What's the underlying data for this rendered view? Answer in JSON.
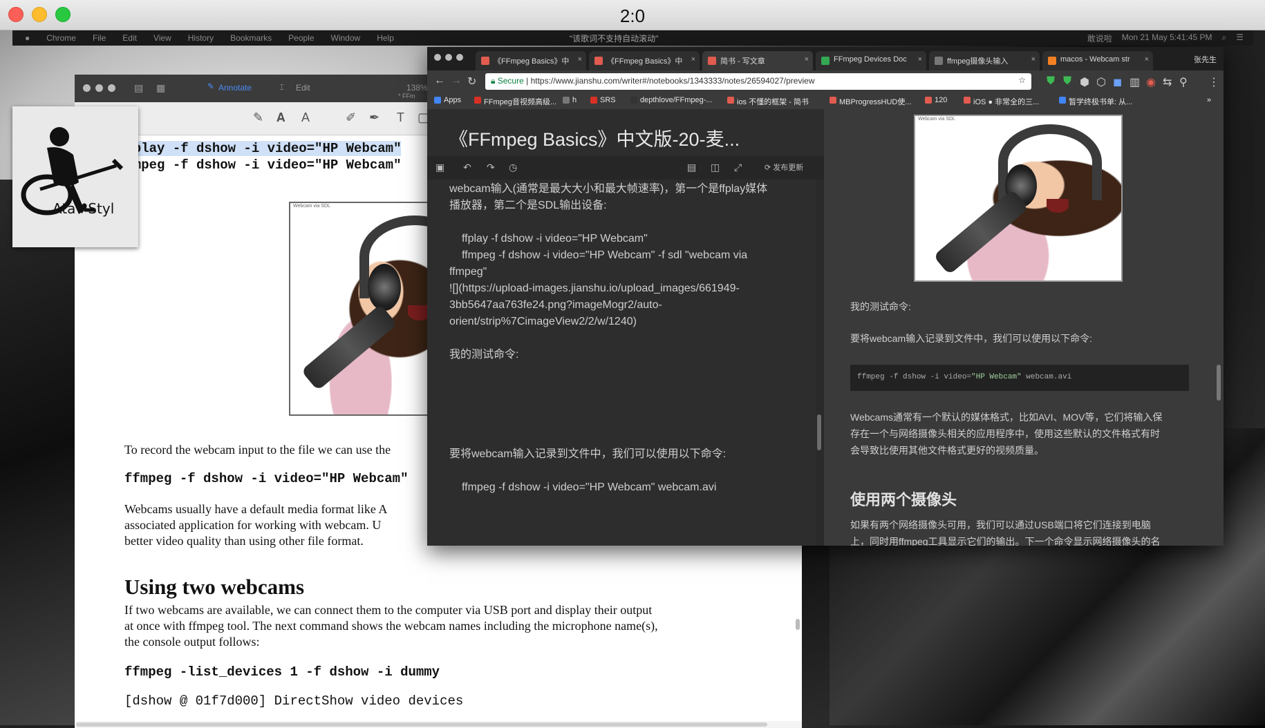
{
  "window": {
    "title": "2:0"
  },
  "menubar": {
    "items": [
      "Chrome",
      "File",
      "Edit",
      "View",
      "History",
      "Bookmarks",
      "People",
      "Window",
      "Help"
    ],
    "center_notice": "\"该歌词不支持自动滚动\"",
    "clock": "Mon 21 May  5:41:45 PM",
    "user": "敢说啦"
  },
  "pdf": {
    "toolbar": {
      "annotate": "Annotate",
      "edit": "Edit",
      "zoom": "138%",
      "filename": "* FFm"
    },
    "tools": [
      "✎",
      "𝐀",
      "A",
      "✐",
      "✒",
      "T",
      "▢"
    ],
    "cmd1": "ffplay -f dshow -i video=\"HP Webcam\"",
    "cmd2": "ffmpeg -f dshow -i video=\"HP Webcam\"",
    "photo_caption": "Webcam via SDL",
    "para1": "To record the webcam input to the file we can use the",
    "cmd3": "ffmpeg -f dshow -i video=\"HP Webcam\"",
    "para2_l1": "Webcams usually have a default media format like A",
    "para2_l2": "associated application for working with webcam. U",
    "para2_l3": "better video quality than using other file format.",
    "heading": "Using two webcams",
    "para3_l1": "If two webcams are available, we can connect them to the computer via USB port and display their output",
    "para3_l2": "at once with ffmpeg tool. The next command shows the webcam names including the microphone name(s),",
    "para3_l3": "the console output follows:",
    "cmd4": "ffmpeg -list_devices 1 -f dshow -i dummy",
    "cmd5": "[dshow @ 01f7d000] DirectShow video devices"
  },
  "logo": {
    "text": "Ata♥Styl"
  },
  "chrome": {
    "tabs": [
      {
        "label": "《FFmpeg Basics》中",
        "color": "#e15b4f"
      },
      {
        "label": "《FFmpeg Basics》中",
        "color": "#e15b4f"
      },
      {
        "label": "简书 - 写文章",
        "color": "#e15b4f"
      },
      {
        "label": "FFmpeg Devices Doc",
        "color": "#34a853"
      },
      {
        "label": "ffmpeg摄像头输入",
        "color": "#777777"
      },
      {
        "label": "macos - Webcam str",
        "color": "#f48024"
      }
    ],
    "profile": "张先生",
    "url_secure": "Secure",
    "url": "https://www.jianshu.com/writer#/notebooks/1343333/notes/26594027/preview",
    "bookmarks": [
      {
        "label": "Apps",
        "color": "#4285f4"
      },
      {
        "label": "FFmpeg音视频高级...",
        "color": "#d93025"
      },
      {
        "label": "h",
        "color": "#777777"
      },
      {
        "label": "SRS",
        "color": "#d93025"
      },
      {
        "label": "depthlove/FFmpeg-...",
        "color": "#333333"
      },
      {
        "label": "ios 不懂的框架 - 简书",
        "color": "#e15b4f"
      },
      {
        "label": "MBProgressHUD使...",
        "color": "#e15b4f"
      },
      {
        "label": "120",
        "color": "#e15b4f"
      },
      {
        "label": "iOS ● 非常全的三...",
        "color": "#e15b4f"
      },
      {
        "label": "暂学终极书单: 从...",
        "color": "#4285f4"
      }
    ]
  },
  "editor": {
    "title": "《FFmpeg Basics》中文版-20-麦...",
    "publish": "发布更新",
    "lines": [
      "webcam输入(通常是最大大小和最大帧速率)，第一个是ffplay媒体",
      "播放器，第二个是SDL输出设备:",
      "ffplay -f dshow -i video=\"HP Webcam\"",
      "ffmpeg -f dshow -i video=\"HP Webcam\" -f sdl \"webcam via",
      "ffmpeg\"",
      "![](https://upload-images.jianshu.io/upload_images/661949-",
      "3bb5647aa763fe24.png?imageMogr2/auto-",
      "orient/strip%7CimageView2/2/w/1240)",
      "我的测试命令:",
      "要将webcam输入记录到文件中，我们可以使用以下命令:",
      "ffmpeg -f dshow -i video=\"HP Webcam\" webcam.avi"
    ]
  },
  "preview": {
    "p1": "我的测试命令:",
    "p2": "要将webcam输入记录到文件中，我们可以使用以下命令:",
    "code_prefix": "ffmpeg -f dshow -i video=",
    "code_string": "\"HP Webcam\"",
    "code_suffix": " webcam.avi",
    "p3_l1": "Webcams通常有一个默认的媒体格式，比如AVI、MOV等，它们将输入保",
    "p3_l2": "存在一个与网络摄像头相关的应用程序中，使用这些默认的文件格式有时",
    "p3_l3": "会导致比使用其他文件格式更好的视频质量。",
    "h2": "使用两个摄像头",
    "p4_l1": "如果有两个网络摄像头可用，我们可以通过USB端口将它们连接到电脑",
    "p4_l2": "上，同时用ffmpeg工具显示它们的输出。下一个命令显示网络摄像头的名"
  }
}
